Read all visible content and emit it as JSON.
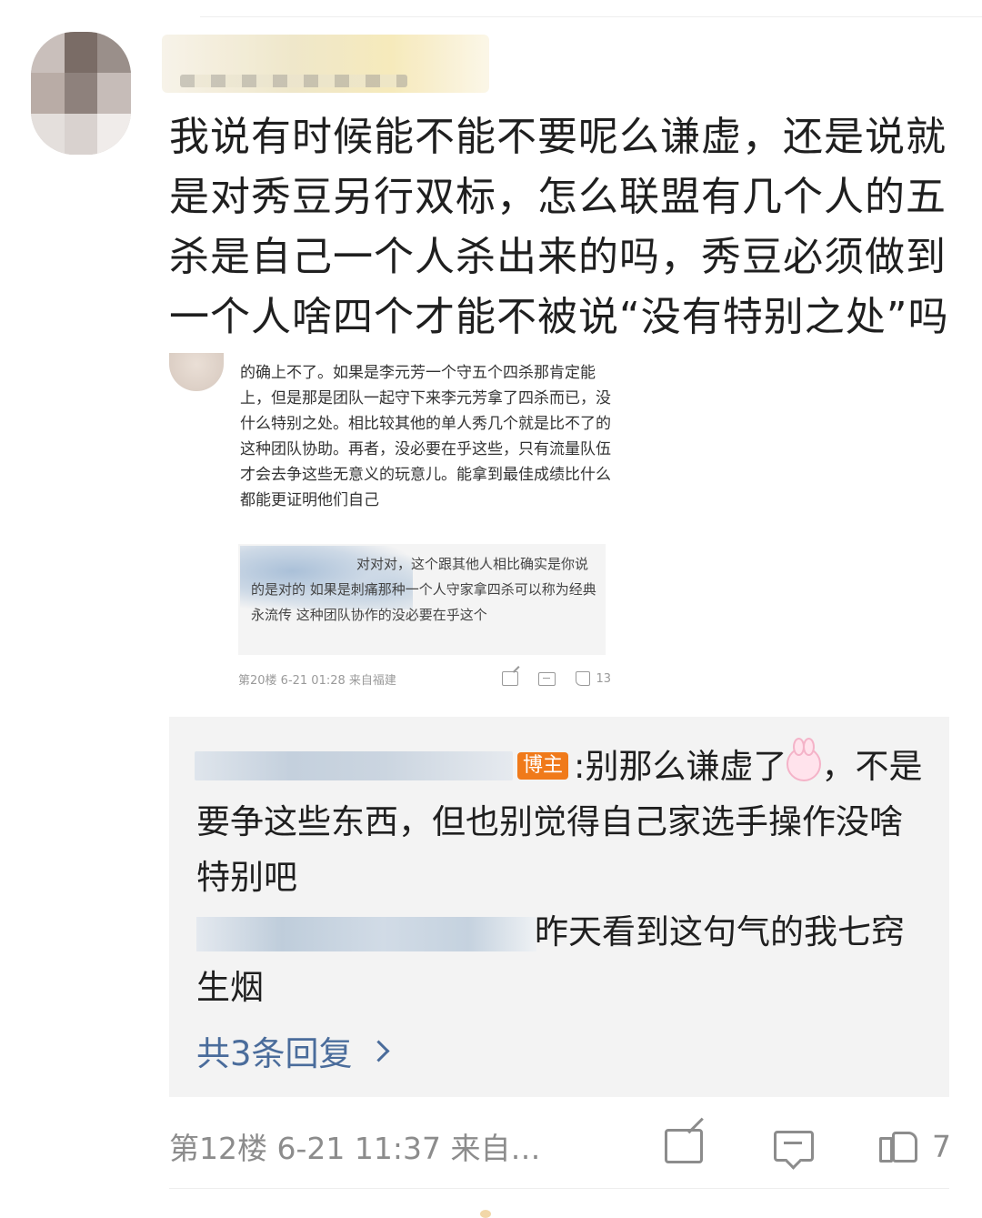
{
  "main_comment": {
    "text": "我说有时候能不能不要呢么谦虚，还是说就是对秀豆另行双标，怎么联盟有几个人的五杀是自己一个人杀出来的吗，秀豆必须做到一个人啥四个才能不被说“没有特别之处”吗"
  },
  "embedded": {
    "text": "的确上不了。如果是李元芳一个守五个四杀那肯定能上，但是那是团队一起守下来李元芳拿了四杀而已，没什么特别之处。相比较其他的单人秀几个就是比不了的这种团队协助。再者，没必要在乎这些，只有流量队伍才会去争这些无意义的玩意儿。能拿到最佳成绩比什么都能更证明他们自己",
    "reply_text": "对对对，这个跟其他人相比确实是你说的是对的 如果是刺痛那种一个人守家拿四杀可以称为经典永流传 这种团队协作的没必要在乎这个",
    "meta": "第20楼 6-21 01:28 来自福建",
    "likes": "13"
  },
  "replies": [
    {
      "badge": "博主",
      "text_before_emoji": ":别那么谦虚了",
      "text_after_emoji": "，不是要争这些东西，但也别觉得自己家选手操作没啥特别吧"
    },
    {
      "text": "昨天看到这句气的我七窍生烟"
    }
  ],
  "more_replies_label": "共3条回复",
  "footer": {
    "meta": "第12楼 6-21 11:37 来自…",
    "likes": "7"
  },
  "colors": {
    "link": "#4a6c9b",
    "badge": "#f07a1a",
    "reply_bg": "#f3f3f3"
  }
}
